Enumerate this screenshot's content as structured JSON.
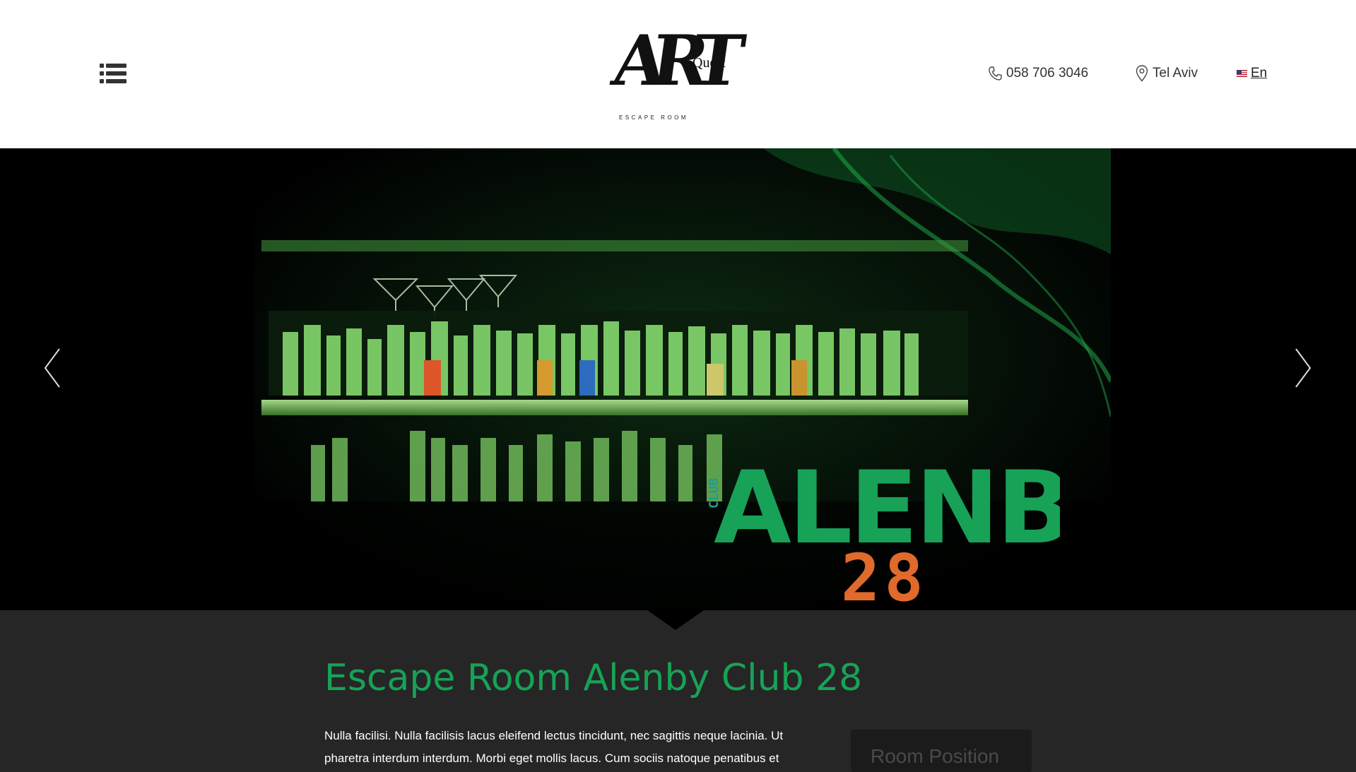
{
  "header": {
    "logo": {
      "main": "ART",
      "word": "Quest",
      "tagline": "ESCAPE ROOM"
    },
    "phone": "058 706 3046",
    "location": "Tel Aviv",
    "language": "En"
  },
  "hero": {
    "banner": {
      "line1": "ALENBY",
      "line2": "28",
      "side": "CLUB"
    },
    "colors": {
      "green": "#17a257",
      "teal": "#1b9e94",
      "orange": "#e06a2c"
    }
  },
  "content": {
    "title": "Escape Room Alenby Club 28",
    "description": "Nulla facilisi. Nulla facilisis lacus eleifend lectus tincidunt, nec sagittis neque lacinia. Ut pharetra interdum interdum. Morbi eget mollis lacus. Cum sociis natoque penatibus et",
    "room_position_label": "Room Position"
  },
  "icons": [
    "menu-icon",
    "phone-icon",
    "map-pin-icon",
    "us-flag-icon",
    "chevron-left-icon",
    "chevron-right-icon"
  ]
}
